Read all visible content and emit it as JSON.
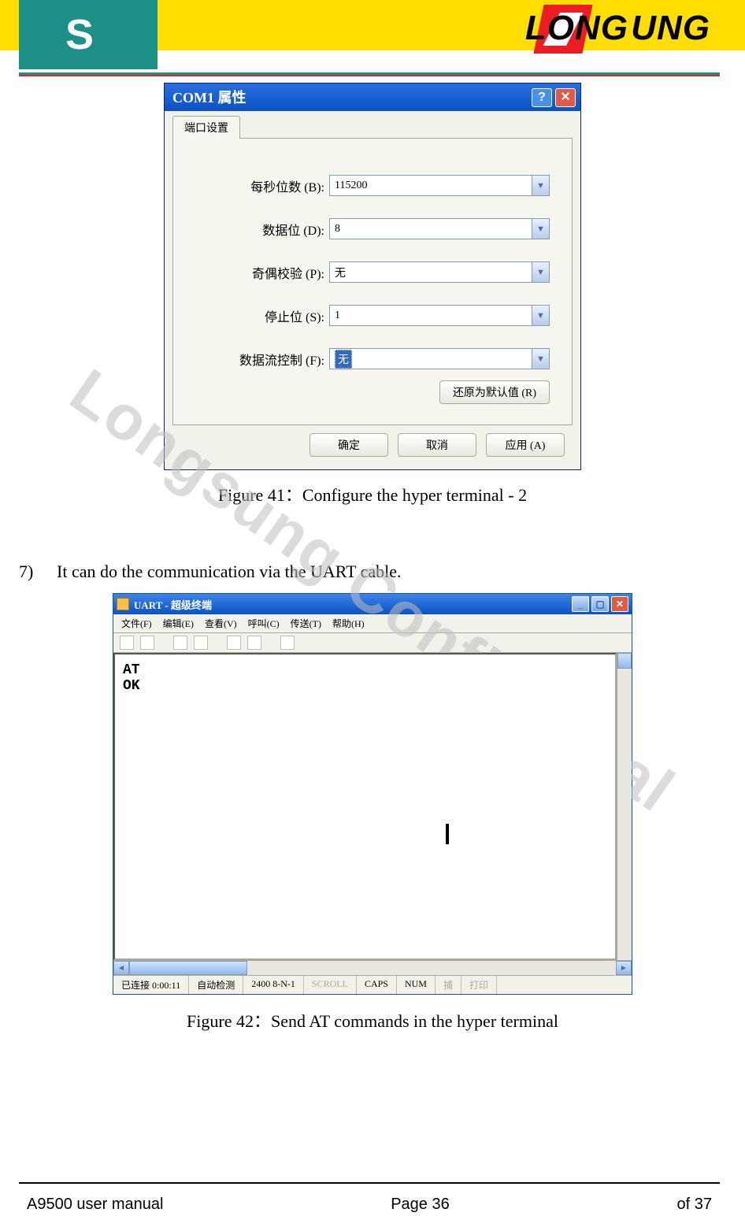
{
  "header": {
    "brand_left": "LONG",
    "brand_right": "UNG"
  },
  "watermark": "Longsung Confidential",
  "com_dialog": {
    "title": "COM1 属性",
    "tab": "端口设置",
    "fields": {
      "baud": {
        "label": "每秒位数 (B):",
        "value": "115200"
      },
      "data": {
        "label": "数据位 (D):",
        "value": "8"
      },
      "parity": {
        "label": "奇偶校验 (P):",
        "value": "无"
      },
      "stop": {
        "label": "停止位 (S):",
        "value": "1"
      },
      "flow": {
        "label": "数据流控制 (F):",
        "value": "无"
      }
    },
    "restore": "还原为默认值 (R)",
    "ok": "确定",
    "cancel": "取消",
    "apply": "应用 (A)"
  },
  "caption1": "Figure 41：Configure the hyper terminal - 2",
  "step7_num": "7)",
  "step7_text": "It can do the communication via the UART cable.",
  "ht": {
    "title": "UART - 超级终端",
    "menu": {
      "file": "文件(F)",
      "edit": "编辑(E)",
      "view": "查看(V)",
      "call": "呼叫(C)",
      "transfer": "传送(T)",
      "help": "帮助(H)"
    },
    "terminal_text": "AT\nOK",
    "status": {
      "conn": "已连接 0:00:11",
      "detect": "自动检测",
      "cfg": "2400 8-N-1",
      "scroll": "SCROLL",
      "caps": "CAPS",
      "num": "NUM",
      "capture": "捕",
      "print": "打印"
    }
  },
  "caption2": "Figure 42：Send AT commands in the hyper terminal",
  "footer": {
    "left": "A9500 user manual",
    "center": "Page 36",
    "right": "of 37"
  }
}
